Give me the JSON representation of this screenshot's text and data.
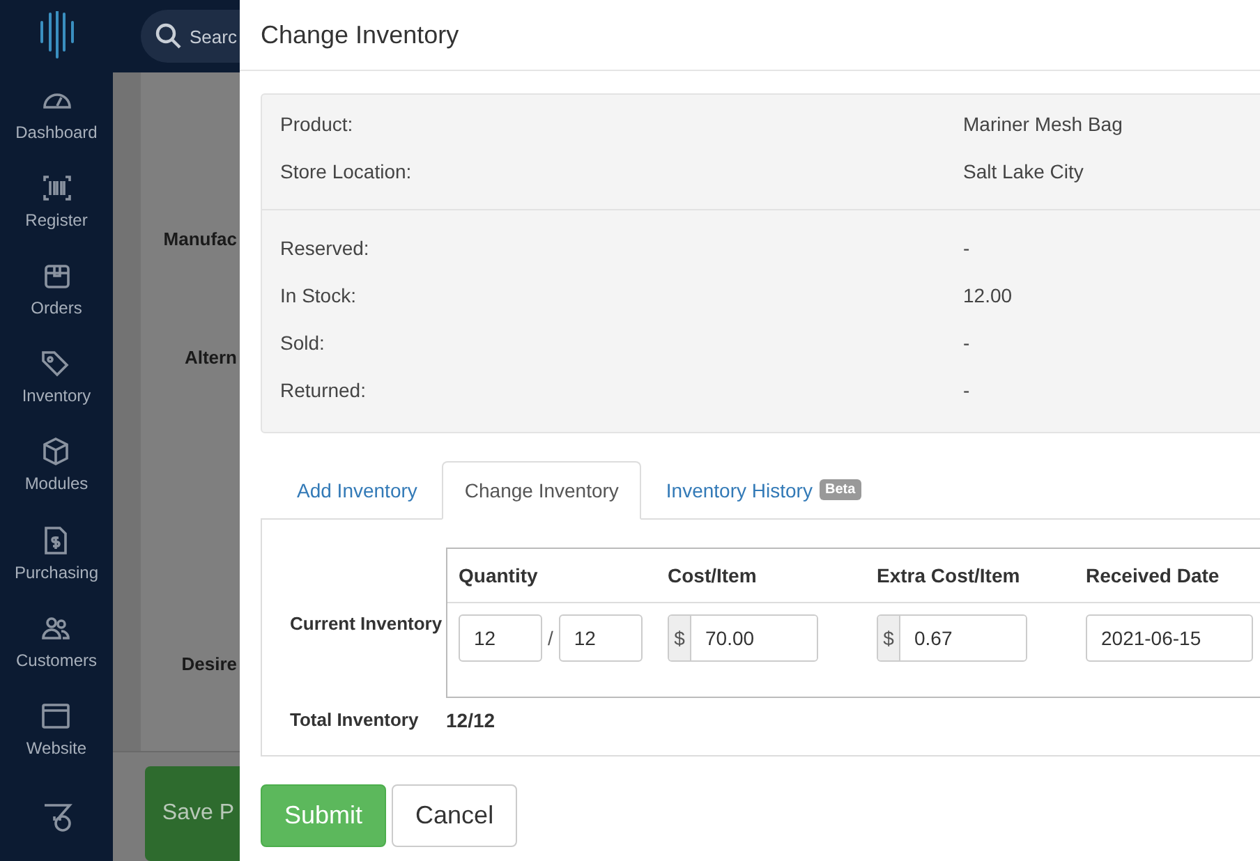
{
  "sidebar": {
    "items": [
      {
        "label": "Dashboard"
      },
      {
        "label": "Register"
      },
      {
        "label": "Orders"
      },
      {
        "label": "Inventory"
      },
      {
        "label": "Modules"
      },
      {
        "label": "Purchasing"
      },
      {
        "label": "Customers"
      },
      {
        "label": "Website"
      }
    ]
  },
  "background": {
    "search": {
      "placeholder": "Searc"
    },
    "labels": [
      "Manufac",
      "Altern",
      "Desire"
    ],
    "save_button": "Save P"
  },
  "modal": {
    "title": "Change Inventory",
    "details": [
      {
        "label": "Product:",
        "value": "Mariner Mesh Bag"
      },
      {
        "label": "Store Location:",
        "value": "Salt Lake City"
      }
    ],
    "stock": [
      {
        "label": "Reserved:",
        "value": "-"
      },
      {
        "label": "In Stock:",
        "value": "12.00"
      },
      {
        "label": "Sold:",
        "value": "-"
      },
      {
        "label": "Returned:",
        "value": "-"
      }
    ],
    "tabs": [
      {
        "label": "Add Inventory",
        "selected": false
      },
      {
        "label": "Change Inventory",
        "selected": true
      },
      {
        "label": "Inventory History",
        "badge": "Beta",
        "selected": false
      }
    ],
    "form": {
      "row_label": "Current Inventory",
      "columns": [
        "Quantity",
        "Cost/Item",
        "Extra Cost/Item",
        "Received Date"
      ],
      "quantity": "12",
      "quantity_separator": "/",
      "quantity_total": "12",
      "currency": "$",
      "cost": "70.00",
      "extra_currency": "$",
      "extra_cost": "0.67",
      "received_date": "2021-06-15",
      "total_label": "Total Inventory",
      "total_value": "12/12"
    },
    "buttons": {
      "submit": "Submit",
      "cancel": "Cancel"
    }
  }
}
